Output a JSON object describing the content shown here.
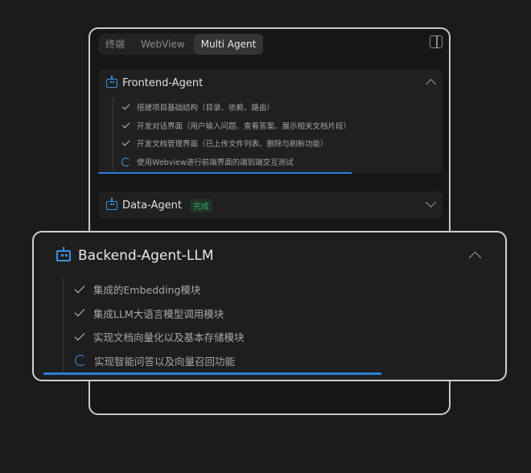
{
  "tabs": [
    "终端",
    "WebView",
    "Multi Agent"
  ],
  "active_tab": "Multi Agent",
  "agents": [
    {
      "name": "Frontend-Agent",
      "expanded": true,
      "steps": [
        {
          "status": "done",
          "text": "搭建项目基础结构（目录、依赖、路由）"
        },
        {
          "status": "done",
          "text": "开发对话界面（用户输入问题、查看答案、展示相关文档片段）"
        },
        {
          "status": "done",
          "text": "开发文档管理界面（已上传文件列表、删除与刷新功能）"
        },
        {
          "status": "running",
          "text": "使用Webview进行前端界面的端到端交互测试"
        }
      ],
      "progress": 0.75
    },
    {
      "name": "Data-Agent",
      "badge": "完成",
      "expanded": false
    }
  ],
  "focused_agent": {
    "name": "Backend-Agent-LLM",
    "steps": [
      {
        "status": "done",
        "text": "集成的Embedding模块"
      },
      {
        "status": "done",
        "text": "集成LLM大语言模型调用模块"
      },
      {
        "status": "done",
        "text": "实现文档向量化以及基本存储模块"
      },
      {
        "status": "running",
        "text": "实现智能问答以及向量召回功能"
      }
    ],
    "progress": 0.75
  },
  "colors": {
    "accent": "#2b7fd6",
    "success": "#3fa564"
  },
  "icons": {
    "agent": "robot-icon",
    "done": "check-icon",
    "running": "spinner-icon",
    "layout": "panel-layout-icon"
  }
}
